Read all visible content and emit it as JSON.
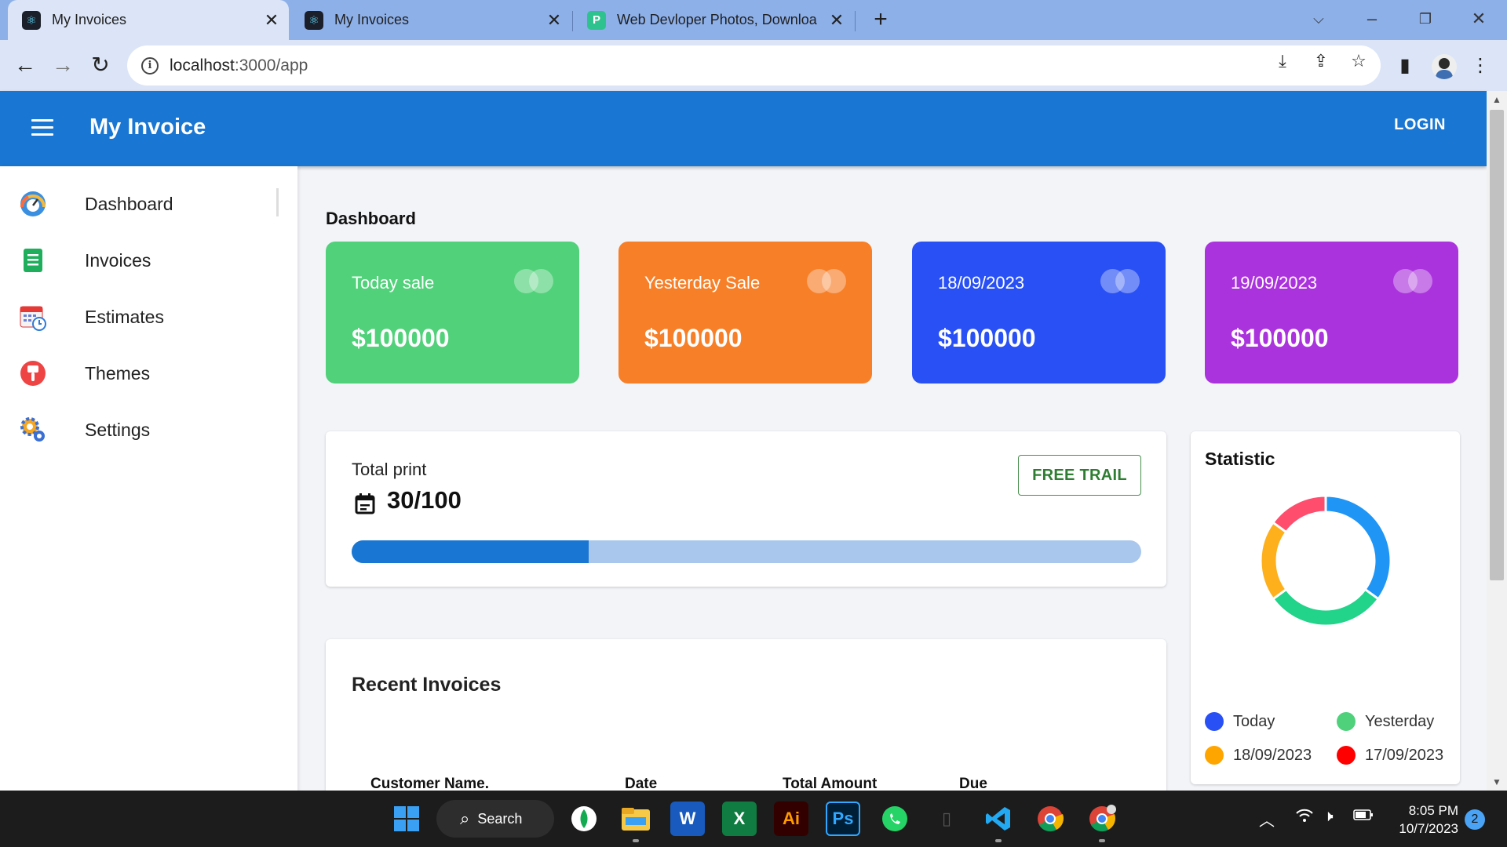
{
  "browser": {
    "tabs": [
      {
        "title": "My Invoices",
        "favicon": "react-icon"
      },
      {
        "title": "My Invoices",
        "favicon": "react-icon"
      },
      {
        "title": "Web Devloper Photos, Downloa",
        "favicon": "pexels-icon"
      }
    ],
    "url_host": "localhost",
    "url_path": ":3000/app"
  },
  "app": {
    "title": "My Invoice",
    "login_label": "LOGIN",
    "brand_color": "#1976d2"
  },
  "sidebar": {
    "items": [
      {
        "label": "Dashboard",
        "icon": "speedometer-icon"
      },
      {
        "label": "Invoices",
        "icon": "document-icon"
      },
      {
        "label": "Estimates",
        "icon": "calendar-clock-icon"
      },
      {
        "label": "Themes",
        "icon": "paint-brush-icon"
      },
      {
        "label": "Settings",
        "icon": "gears-icon"
      }
    ]
  },
  "dashboard": {
    "heading": "Dashboard",
    "cards": [
      {
        "label": "Today sale",
        "value": "$100000",
        "color": "#51d17a"
      },
      {
        "label": "Yesterday Sale",
        "value": "$100000",
        "color": "#f77f28"
      },
      {
        "label": "18/09/2023",
        "value": "$100000",
        "color": "#2850f5"
      },
      {
        "label": "19/09/2023",
        "value": "$100000",
        "color": "#ab33dd"
      }
    ],
    "print": {
      "label": "Total print",
      "value": "30/100",
      "progress_fraction": 0.3,
      "free_trial_label": "FREE TRAIL"
    },
    "statistic": {
      "title": "Statistic",
      "legend": [
        {
          "label": "Today",
          "color": "#2850f5"
        },
        {
          "label": "Yesterday",
          "color": "#4fd17c"
        },
        {
          "label": "18/09/2023",
          "color": "#ffa500"
        },
        {
          "label": "17/09/2023",
          "color": "#ff0000"
        }
      ]
    },
    "recent": {
      "title": "Recent Invoices",
      "columns": [
        "Customer Name.",
        "Date",
        "Total Amount",
        "Due"
      ]
    }
  },
  "chart_data": {
    "type": "pie",
    "title": "Statistic",
    "categories": [
      "Blue",
      "Green",
      "Yellow",
      "Pink"
    ],
    "values": [
      35,
      30,
      20,
      15
    ],
    "colors": [
      "#1f95f5",
      "#22d38a",
      "#fdb01c",
      "#ff4d6d"
    ]
  },
  "taskbar": {
    "search_label": "Search",
    "time": "8:05 PM",
    "date": "10/7/2023",
    "notification_count": "2"
  }
}
